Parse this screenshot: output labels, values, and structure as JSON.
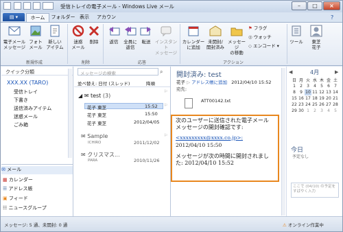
{
  "window": {
    "title": "受信トレイの電子メール - Windows Live メール"
  },
  "tabs": [
    "ホーム",
    "フォルダー",
    "表示",
    "アカウント"
  ],
  "ribbon": {
    "new_group": {
      "buttons": [
        "電子メール\nメッセージ",
        "フォト\nメール",
        "新しい\nアイテム"
      ],
      "label": "新規作成"
    },
    "delete_group": {
      "buttons": [
        "迷惑\nメール",
        "削除"
      ],
      "label": "削除"
    },
    "respond_group": {
      "buttons": [
        "返信",
        "全員に\n返信",
        "転送",
        "インスタント\nメッセージ"
      ],
      "label": "応答"
    },
    "actions_group": {
      "buttons": [
        "カレンダー\nに追加",
        "未開封/\n開封済み",
        "メッセージ\nの移動"
      ],
      "small": [
        "フラグ",
        "ウォッチ",
        "エンコード"
      ],
      "label": "アクション"
    },
    "tools_group": {
      "buttons": [
        "ツール"
      ]
    },
    "account": {
      "label": "東芝\n花子"
    }
  },
  "sidebar": {
    "quick_views": "クイック分類",
    "account": "XXX.XX (TARO)",
    "folders": [
      "受信トレイ",
      "下書き",
      "送信済みアイテム",
      "迷惑メール",
      "ごみ箱"
    ],
    "nav": [
      "メール",
      "カレンダー",
      "アドレス帳",
      "フィード",
      "ニュースグループ"
    ]
  },
  "list": {
    "search_placeholder": "メッセージの検索",
    "sort": "並べ替え: 日付 (スレッド)",
    "order": "降順",
    "threads": [
      {
        "name": "test",
        "count": "(3)",
        "date": ""
      },
      {
        "name": "花子 東芝",
        "date": "15:52",
        "selected": true
      },
      {
        "name": "花子 東芝",
        "date": "15:50"
      },
      {
        "name": "花子 東芝",
        "date": "2012/04/05"
      },
      {
        "name": "Sample",
        "sub": "ICHIRO",
        "date": "2011/12/02"
      },
      {
        "name": "クリスマス...",
        "sub": "PARA",
        "date": "2010/11/26"
      }
    ]
  },
  "reading": {
    "subject": "開封済み: test",
    "from_name": "花子",
    "from_link": "アドレス帳に追加",
    "date": "2012/04/10 15:52",
    "to_label": "宛先:",
    "attachment": "ATT00142.txt",
    "body_line1": "次のユーザーに送信された電子メール メッセージの開封確認です:",
    "body_email": "<xxxxxxxxx@xxxx.co.jp>:",
    "body_time1": "2012/04/10 15:50",
    "body_line2": "メッセージが次の時間に開封されました: 2012/04/10 15:52"
  },
  "calendar": {
    "month": "4月",
    "weekdays": [
      "日",
      "月",
      "火",
      "水",
      "木",
      "金",
      "土"
    ],
    "weeks": [
      [
        "1",
        "2",
        "3",
        "4",
        "5",
        "6",
        "7"
      ],
      [
        "8",
        "9",
        "10",
        "11",
        "12",
        "13",
        "14"
      ],
      [
        "15",
        "16",
        "17",
        "18",
        "19",
        "20",
        "21"
      ],
      [
        "22",
        "23",
        "24",
        "25",
        "26",
        "27",
        "28"
      ],
      [
        "29",
        "30",
        "1",
        "2",
        "3",
        "4",
        "5"
      ]
    ],
    "today_label": "今日",
    "today_sub": "予定なし",
    "quick_add": "ここで (04/10) の予定をすばやく入力"
  },
  "status": {
    "counts": "メッセージ: 5 通、未開封: 0 通",
    "online": "オンライン作業中"
  },
  "colors": {
    "highlight": "#e8871e",
    "link": "#1a55b8",
    "selected": "#cfe0f7"
  }
}
